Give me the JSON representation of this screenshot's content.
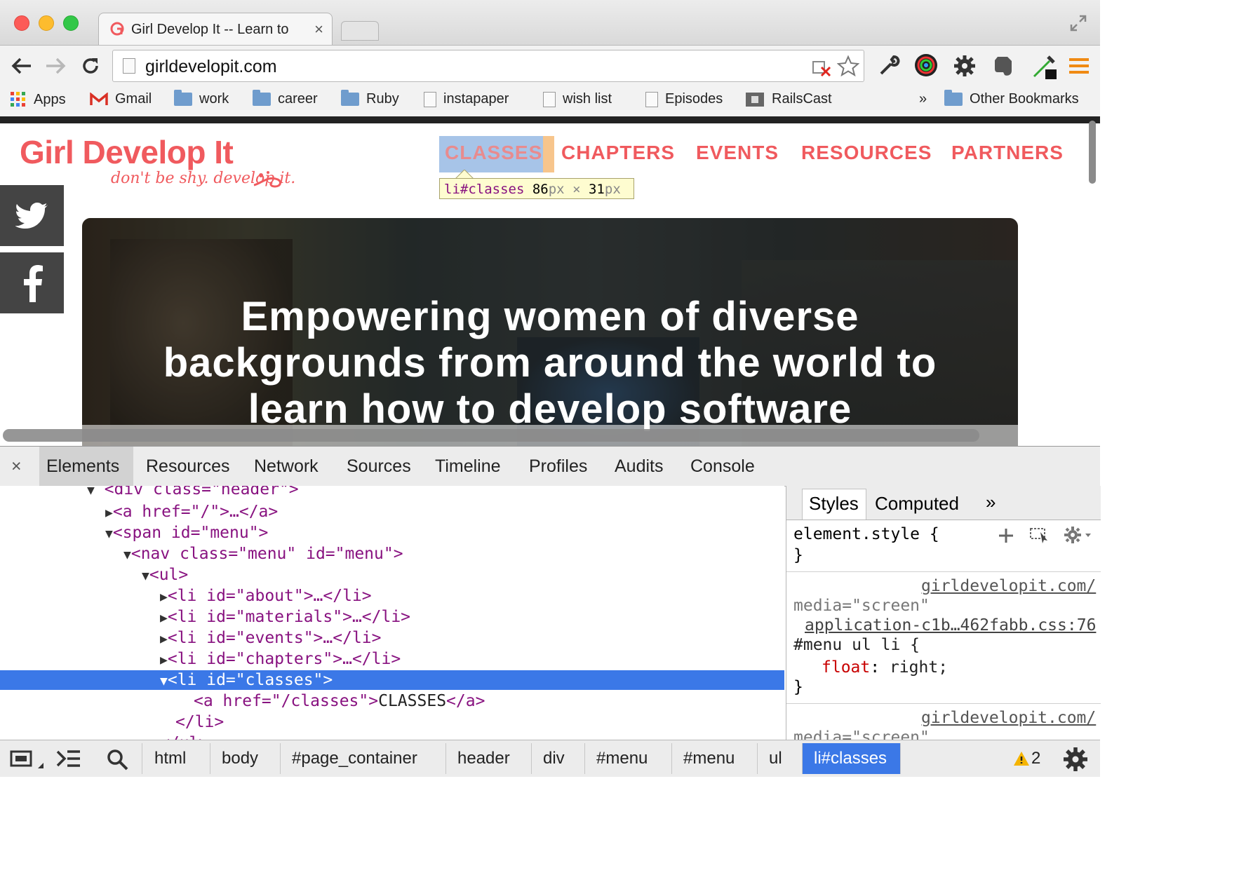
{
  "browser": {
    "tab_title": "Girl Develop It -- Learn to",
    "tab_close": "×",
    "url": "girldevelopit.com"
  },
  "bookmarks": {
    "items": [
      "Apps",
      "Gmail",
      "work",
      "career",
      "Ruby",
      "instapaper",
      "wish list",
      "Episodes",
      "RailsCast"
    ],
    "overflow": "»",
    "other": "Other Bookmarks"
  },
  "site": {
    "logo": "Girl Develop It",
    "tagline": "don't be shy. develop it.",
    "nav": [
      "CLASSES",
      "CHAPTERS",
      "EVENTS",
      "RESOURCES",
      "PARTNERS"
    ],
    "hero_lines": [
      "Empowering women of diverse",
      "backgrounds from around the world to",
      "learn how to develop software"
    ]
  },
  "inspector_tooltip": {
    "selector": "li#classes",
    "width": "86",
    "height": "31",
    "unit": "px",
    "times": "×"
  },
  "devtools": {
    "close": "×",
    "tabs": [
      "Elements",
      "Resources",
      "Network",
      "Sources",
      "Timeline",
      "Profiles",
      "Audits",
      "Console"
    ],
    "dom": {
      "div_header": "<div class=\"header\">",
      "a_home": "<a href=\"/\">…</a>",
      "span_menu": "<span id=\"menu\">",
      "nav_menu": "<nav class=\"menu\" id=\"menu\">",
      "ul": "<ul>",
      "li_about": "<li id=\"about\">…</li>",
      "li_materials": "<li id=\"materials\">…</li>",
      "li_events": "<li id=\"events\">…</li>",
      "li_chapters": "<li id=\"chapters\">…</li>",
      "li_classes": "<li id=\"classes\">",
      "a_classes_open": "<a href=\"/classes\">",
      "a_classes_text": "CLASSES",
      "a_classes_close": "</a>",
      "li_close": "</li>",
      "ul_close": "</ul>"
    },
    "styles": {
      "tabs": [
        "Styles",
        "Computed"
      ],
      "overflow": "»",
      "element_style": "element.style {",
      "close_brace": "}",
      "rule1_link": "girldevelopit.com/",
      "rule1_media": "media=\"screen\"",
      "rule1_file": "application-c1b…462fabb.css:76",
      "rule1_selector": "#menu ul li {",
      "rule1_prop": "float",
      "rule1_value": "right;",
      "rule2_link": "girldevelopit.com/",
      "rule2_media": "media=\"screen\""
    },
    "breadcrumbs": [
      "html",
      "body",
      "#page_container",
      "header",
      "div",
      "#menu",
      "#menu",
      "ul",
      "li#classes"
    ],
    "warnings": "2"
  },
  "colors": {
    "brand": "#f05a5e",
    "selection": "#3b78e7",
    "highlight_content": "#a7c4e8",
    "highlight_padding": "#f7c58c"
  }
}
